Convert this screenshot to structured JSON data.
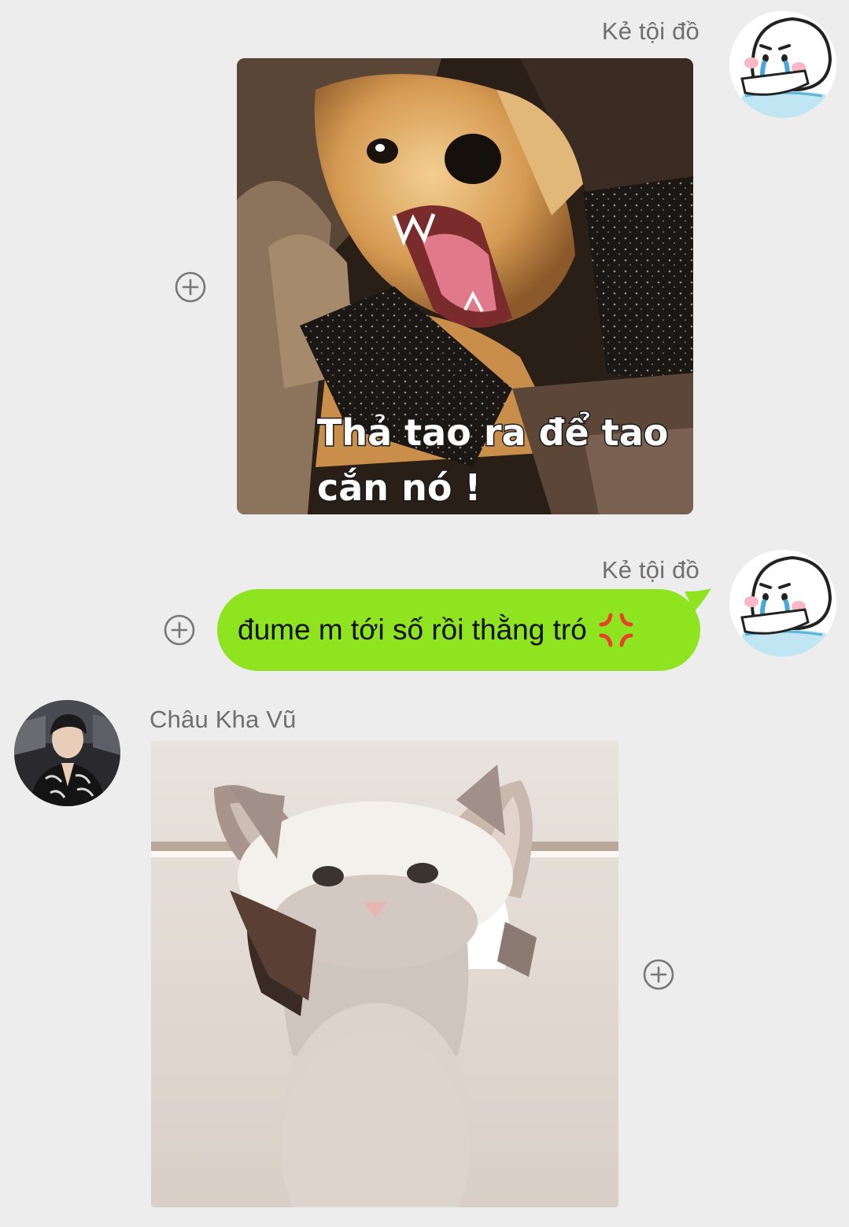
{
  "messages": [
    {
      "sender": "Kẻ tội đồ",
      "kind": "image",
      "image_caption_line1": "Thả tao ra để tao",
      "image_caption_line2": "cắn nó !"
    },
    {
      "sender": "Kẻ tội đồ",
      "kind": "text",
      "text": "đume m tới số rồi thằng tró",
      "emoji": "anger-symbol-icon"
    },
    {
      "sender": "Châu Kha Vũ",
      "kind": "image"
    }
  ],
  "colors": {
    "background": "#ededed",
    "bubble_outgoing": "#8de41f",
    "name_text": "#6f6f6f"
  }
}
